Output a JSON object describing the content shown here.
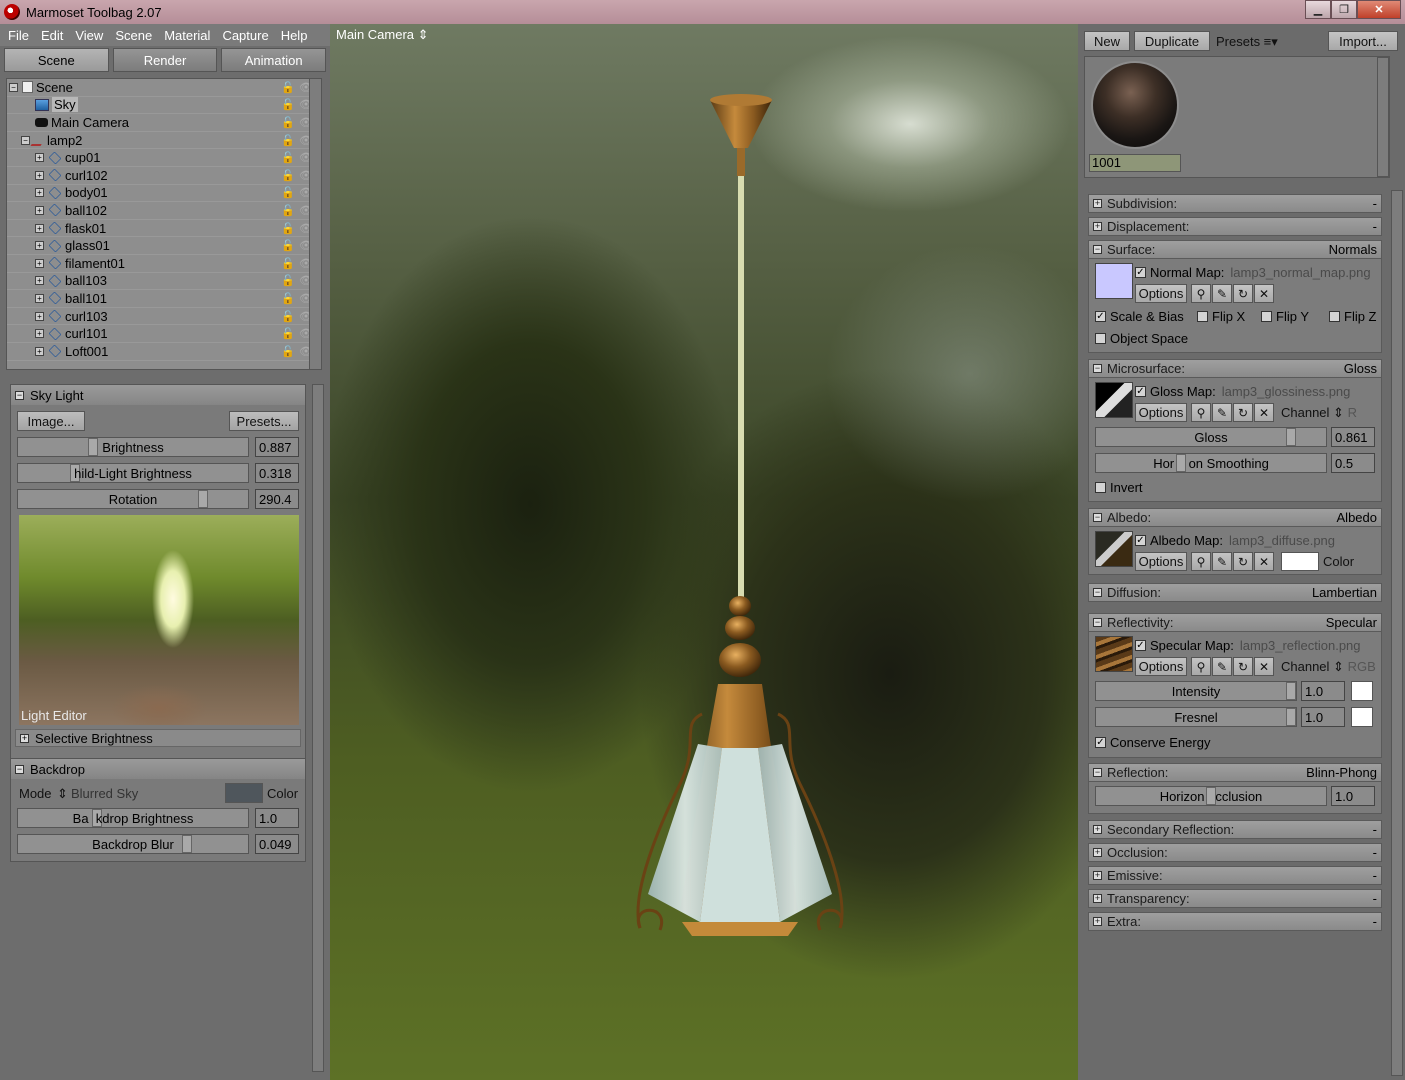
{
  "window": {
    "title": "Marmoset Toolbag 2.07",
    "min": "▁",
    "max": "❐",
    "close": "✕"
  },
  "menu": [
    "File",
    "Edit",
    "View",
    "Scene",
    "Material",
    "Capture",
    "Help"
  ],
  "left_tabs": [
    "Scene",
    "Render",
    "Animation"
  ],
  "tree": {
    "root": "Scene",
    "sky": "Sky",
    "camera": "Main Camera",
    "group": "lamp2",
    "children": [
      "cup01",
      "curl102",
      "body01",
      "ball102",
      "flask01",
      "glass01",
      "filament01",
      "ball103",
      "ball101",
      "curl103",
      "curl101",
      "Loft001"
    ]
  },
  "sky_light": {
    "title": "Sky Light",
    "image_button": "Image...",
    "presets_button": "Presets...",
    "brightness_label": "Brightness",
    "brightness_value": "0.887",
    "child_label": "hild-Light Brightness",
    "child_value": "0.318",
    "rotation_label": "Rotation",
    "rotation_value": "290.4",
    "light_editor": "Light Editor",
    "selective": "Selective Brightness"
  },
  "backdrop": {
    "title": "Backdrop",
    "mode_label": "Mode",
    "mode_value": "Blurred Sky",
    "color_label": "Color",
    "color_swatch": "#4f565c",
    "brightness_label": "Ba  kdrop Brightness",
    "brightness_value": "1.0",
    "blur_label": "Backdrop Blur",
    "blur_value": "0.049"
  },
  "viewport": {
    "camera": "Main Camera"
  },
  "right_top": {
    "new": "New",
    "duplicate": "Duplicate",
    "presets": "Presets ≡▾",
    "import": "Import..."
  },
  "material": {
    "name": "1001"
  },
  "sections": {
    "subdivision": {
      "label": "Subdivision:",
      "value": "-"
    },
    "displacement": {
      "label": "Displacement:",
      "value": "-"
    },
    "surface": {
      "label": "Surface:",
      "value": "Normals",
      "map_label": "Normal Map:",
      "map_file": "lamp3_normal_map.png",
      "options": "Options",
      "scale_bias": "Scale & Bias",
      "flip_x": "Flip X",
      "flip_y": "Flip Y",
      "flip_z": "Flip Z",
      "object_space": "Object Space",
      "swatch": "#c9c8ff"
    },
    "microsurface": {
      "label": "Microsurface:",
      "value": "Gloss",
      "map_label": "Gloss Map:",
      "map_file": "lamp3_glossiness.png",
      "options": "Options",
      "channel_label": "Channel",
      "channel_value": "R",
      "gloss_label": "Gloss",
      "gloss_value": "0.861",
      "horizon_label": "Hor    on Smoothing",
      "horizon_value": "0.5",
      "invert": "Invert"
    },
    "albedo": {
      "label": "Albedo:",
      "value": "Albedo",
      "map_label": "Albedo Map:",
      "map_file": "lamp3_diffuse.png",
      "options": "Options",
      "color_label": "Color"
    },
    "diffusion": {
      "label": "Diffusion:",
      "value": "Lambertian"
    },
    "reflectivity": {
      "label": "Reflectivity:",
      "value": "Specular",
      "map_label": "Specular Map:",
      "map_file": "lamp3_reflection.png",
      "options": "Options",
      "channel_label": "Channel",
      "channel_value": "RGB",
      "intensity_label": "Intensity",
      "intensity_value": "1.0",
      "fresnel_label": "Fresnel",
      "fresnel_value": "1.0",
      "conserve": "Conserve Energy"
    },
    "reflection": {
      "label": "Reflection:",
      "value": "Blinn-Phong",
      "horizon_label": "Horizon   cclusion",
      "horizon_value": "1.0"
    },
    "secondary": {
      "label": "Secondary Reflection:",
      "value": "-"
    },
    "occlusion": {
      "label": "Occlusion:",
      "value": "-"
    },
    "emissive": {
      "label": "Emissive:",
      "value": "-"
    },
    "transparency": {
      "label": "Transparency:",
      "value": "-"
    },
    "extra": {
      "label": "Extra:",
      "value": "-"
    }
  }
}
